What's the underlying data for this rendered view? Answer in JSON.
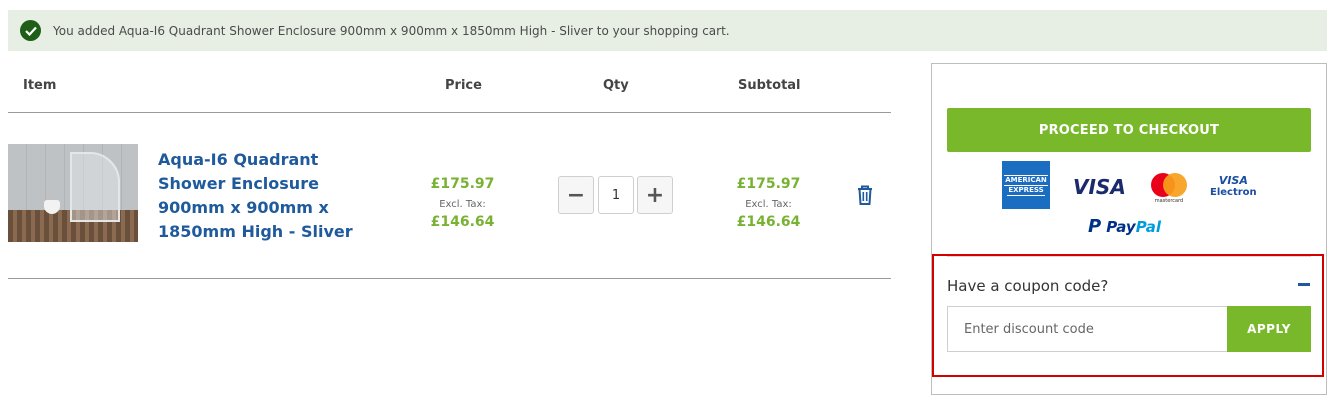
{
  "notice": {
    "message": "You added Aqua-I6 Quadrant Shower Enclosure 900mm x 900mm x 1850mm High - Sliver to your shopping cart."
  },
  "table": {
    "headers": {
      "item": "Item",
      "price": "Price",
      "qty": "Qty",
      "subtotal": "Subtotal"
    }
  },
  "cart_item": {
    "name": "Aqua-I6 Quadrant Shower Enclosure 900mm x 900mm x 1850mm High - Sliver",
    "price": "£175.97",
    "price_excl_label": "Excl. Tax:",
    "price_excl": "£146.64",
    "qty": "1",
    "qty_minus": "−",
    "qty_plus": "+",
    "subtotal": "£175.97",
    "subtotal_excl_label": "Excl. Tax:",
    "subtotal_excl": "£146.64"
  },
  "summary": {
    "checkout_label": "PROCEED TO CHECKOUT",
    "payment_methods": {
      "amex_line1": "AMERICAN",
      "amex_line2": "EXPRESS",
      "visa": "VISA",
      "mastercard": "mastercard",
      "visa_electron_1": "VISA",
      "visa_electron_2": "Electron",
      "paypal_pay": "Pay",
      "paypal_pal": "Pal"
    },
    "coupon": {
      "title": "Have a coupon code?",
      "placeholder": "Enter discount code",
      "apply_label": "APPLY"
    }
  },
  "colors": {
    "accent_green": "#78b82a",
    "link_blue": "#1f5a9c",
    "highlight_red": "#d30000"
  }
}
